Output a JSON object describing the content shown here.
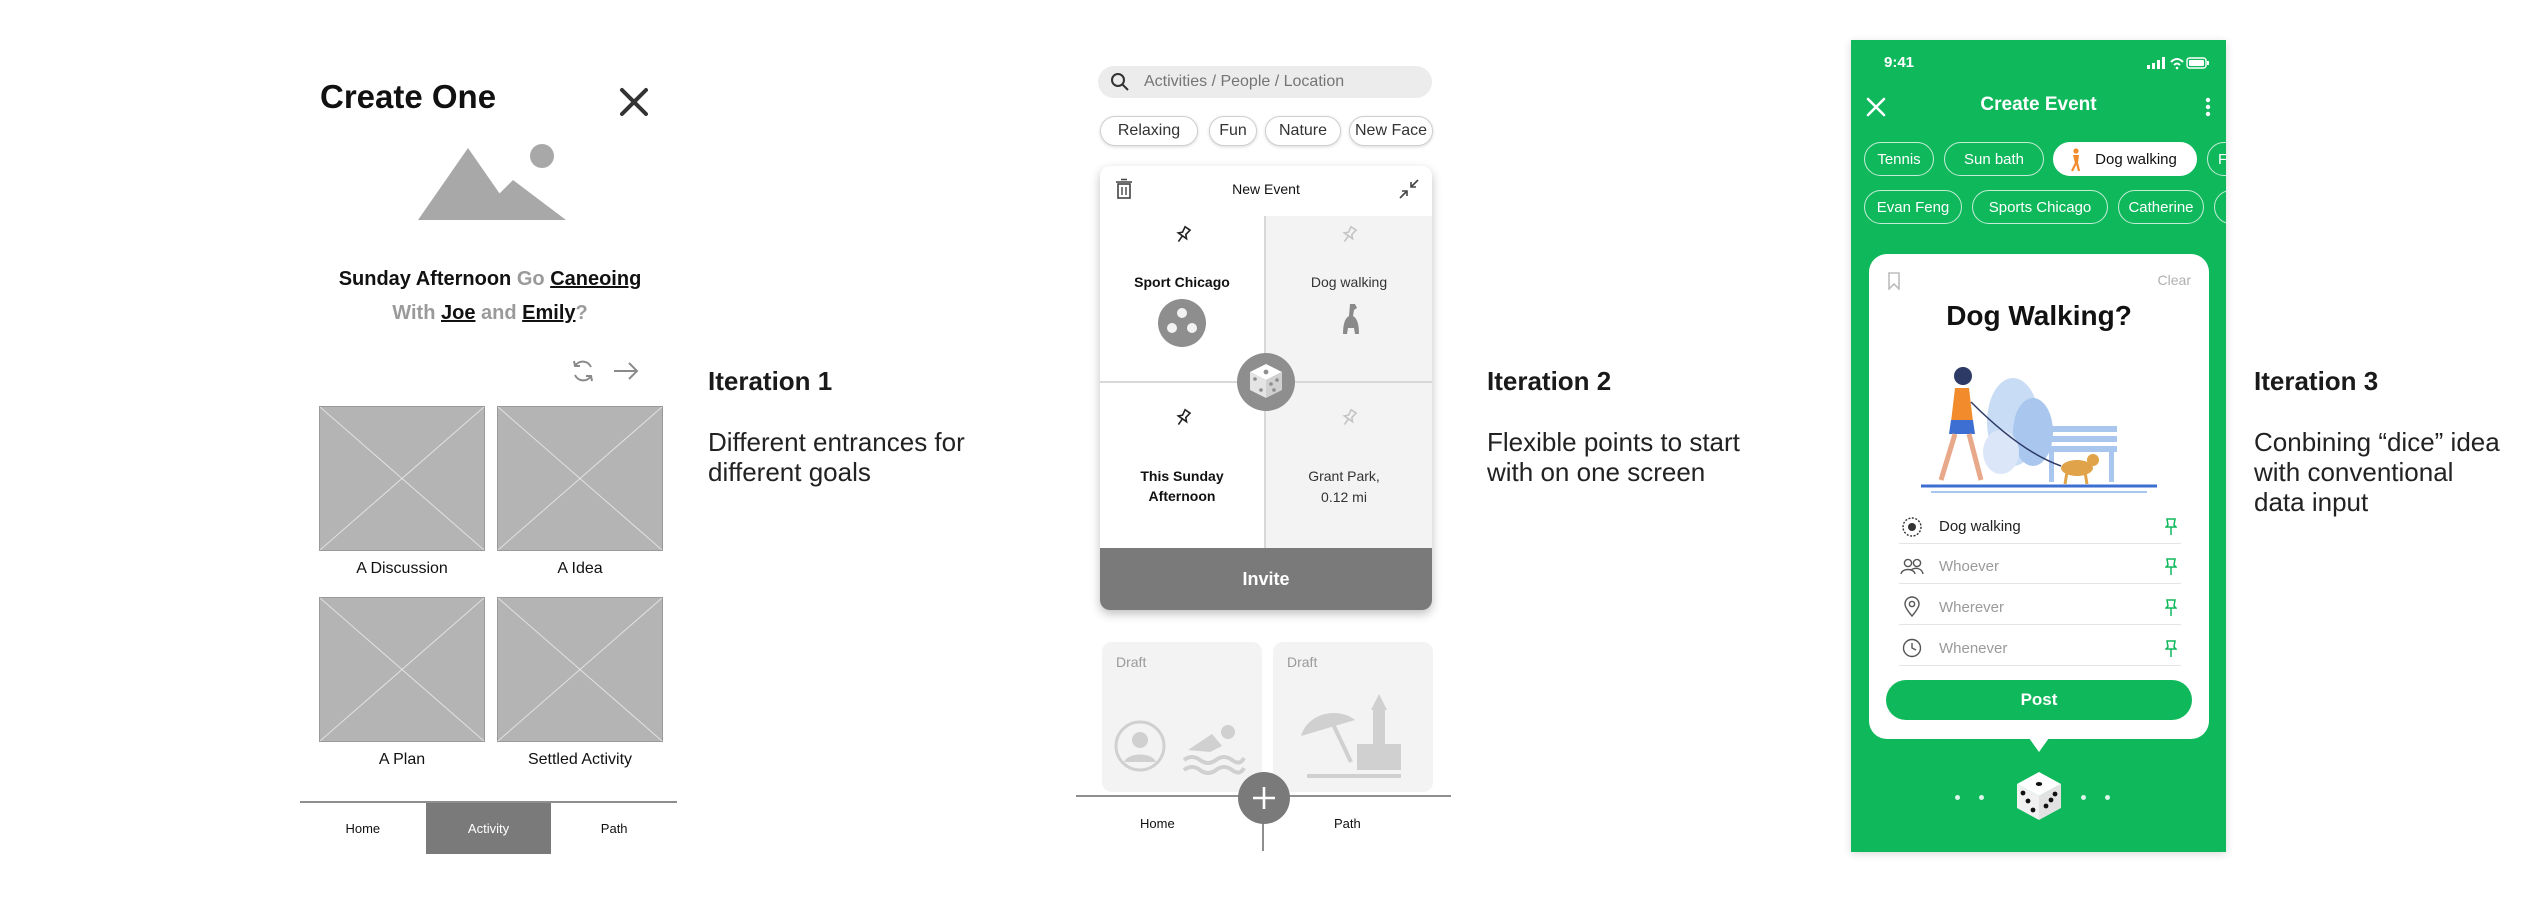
{
  "iteration1": {
    "title": "Create One",
    "line1": {
      "when": "Sunday Afternoon",
      "go": "Go",
      "activity": "Caneoing"
    },
    "line2": {
      "with": "With",
      "person1": "Joe",
      "and": "and",
      "person2": "Emily",
      "end": "?"
    },
    "tiles": [
      "A Discussion",
      "A Idea",
      "A Plan",
      "Settled Activity"
    ],
    "nav": [
      "Home",
      "Activity",
      "Path"
    ],
    "active_nav": "Activity",
    "caption_title": "Iteration 1",
    "caption_body": "Different entrances for different goals"
  },
  "iteration2": {
    "search_placeholder": "Activities / People / Location",
    "chips": [
      "Relaxing",
      "Fun",
      "Nature",
      "New Face"
    ],
    "card_title": "New Event",
    "cells": {
      "top_left": "Sport Chicago",
      "top_right": "Dog walking",
      "bottom_left": "This Sunday Afternoon",
      "bottom_right_line1": "Grant Park,",
      "bottom_right_line2": "0.12 mi"
    },
    "invite_label": "Invite",
    "draft_label": "Draft",
    "nav": [
      "Home",
      "Path"
    ],
    "caption_title": "Iteration 2",
    "caption_body": "Flexible points to start with on one screen"
  },
  "iteration3": {
    "status_time": "9:41",
    "title": "Create Event",
    "chips_row1": [
      "Tennis",
      "Sun bath",
      "Dog walking",
      "F"
    ],
    "chips_row2": [
      "Evan Feng",
      "Sports Chicago",
      "Catherine",
      ""
    ],
    "heading": "Dog Walking?",
    "clear_label": "Clear",
    "fields": [
      {
        "value": "Dog walking",
        "filled": true
      },
      {
        "value": "Whoever",
        "filled": false
      },
      {
        "value": "Wherever",
        "filled": false
      },
      {
        "value": "Whenever",
        "filled": false
      }
    ],
    "post_label": "Post",
    "caption_title": "Iteration 3",
    "caption_body_line1": "Conbining “dice” idea",
    "caption_body_line2": "with conventional",
    "caption_body_line3": "data input"
  },
  "colors": {
    "accent_green": "#10b85c",
    "wireframe_gray": "#b4b4b4",
    "active_gray": "#7a7a7a",
    "person_orange": "#f28b2c"
  }
}
